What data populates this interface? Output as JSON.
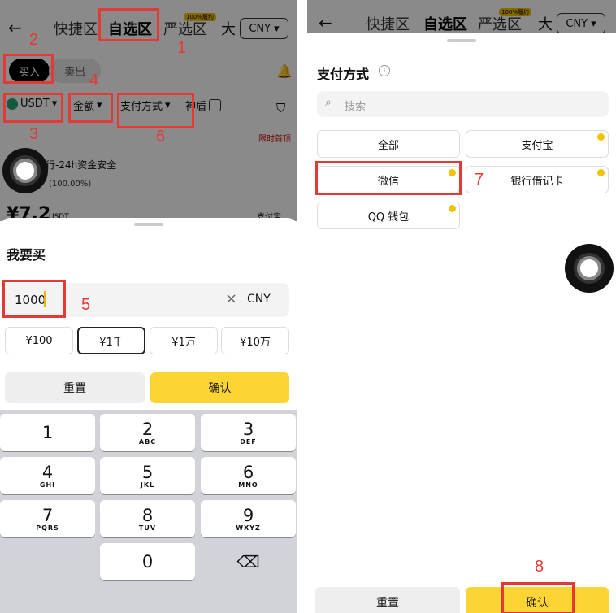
{
  "left": {
    "nav": {
      "back": "←",
      "tab1": "快捷区",
      "tab2": "自选区",
      "tab3": "严选区",
      "badge": "100%履约",
      "big": "大",
      "currency": "CNY",
      "caret": "▾"
    },
    "tabs": {
      "buy": "买入",
      "sell": "卖出"
    },
    "filters": {
      "coin": "USDT",
      "amount": "金额",
      "payment": "支付方式",
      "shield": "神盾"
    },
    "listing": {
      "limited": "限时首顶",
      "merchant": "商行-24h资金安全",
      "rate": "(100.00%)",
      "price_prefix": "¥",
      "price": "7.2",
      "unit": "USDT",
      "paytag": "支付宝"
    },
    "sheet": {
      "title": "我要买",
      "amount_value": "1000",
      "clear": "×",
      "currency": "CNY",
      "quick": [
        "¥100",
        "¥1千",
        "¥1万",
        "¥10万"
      ],
      "reset": "重置",
      "confirm": "确认"
    },
    "keys": [
      {
        "num": "1",
        "letters": ""
      },
      {
        "num": "2",
        "letters": "ABC"
      },
      {
        "num": "3",
        "letters": "DEF"
      },
      {
        "num": "4",
        "letters": "GHI"
      },
      {
        "num": "5",
        "letters": "JKL"
      },
      {
        "num": "6",
        "letters": "MNO"
      },
      {
        "num": "7",
        "letters": "PQRS"
      },
      {
        "num": "8",
        "letters": "TUV"
      },
      {
        "num": "9",
        "letters": "WXYZ"
      },
      {
        "num": "0",
        "letters": ""
      }
    ],
    "delete_key": "⌫"
  },
  "right": {
    "nav": {
      "back": "←",
      "tab1": "快捷区",
      "tab2": "自选区",
      "tab3": "严选区",
      "badge": "100%履约",
      "big": "大",
      "currency": "CNY",
      "caret": "▾"
    },
    "title": "支付方式",
    "info": "i",
    "search_placeholder": "搜索",
    "options": [
      "全部",
      "支付宝",
      "微信",
      "银行借记卡",
      "QQ 钱包"
    ],
    "reset": "重置",
    "confirm": "确认"
  },
  "annotations": [
    "1",
    "2",
    "3",
    "4",
    "5",
    "6",
    "7",
    "8"
  ],
  "colors": {
    "accent": "#fcd535",
    "highlight": "#e53935"
  }
}
